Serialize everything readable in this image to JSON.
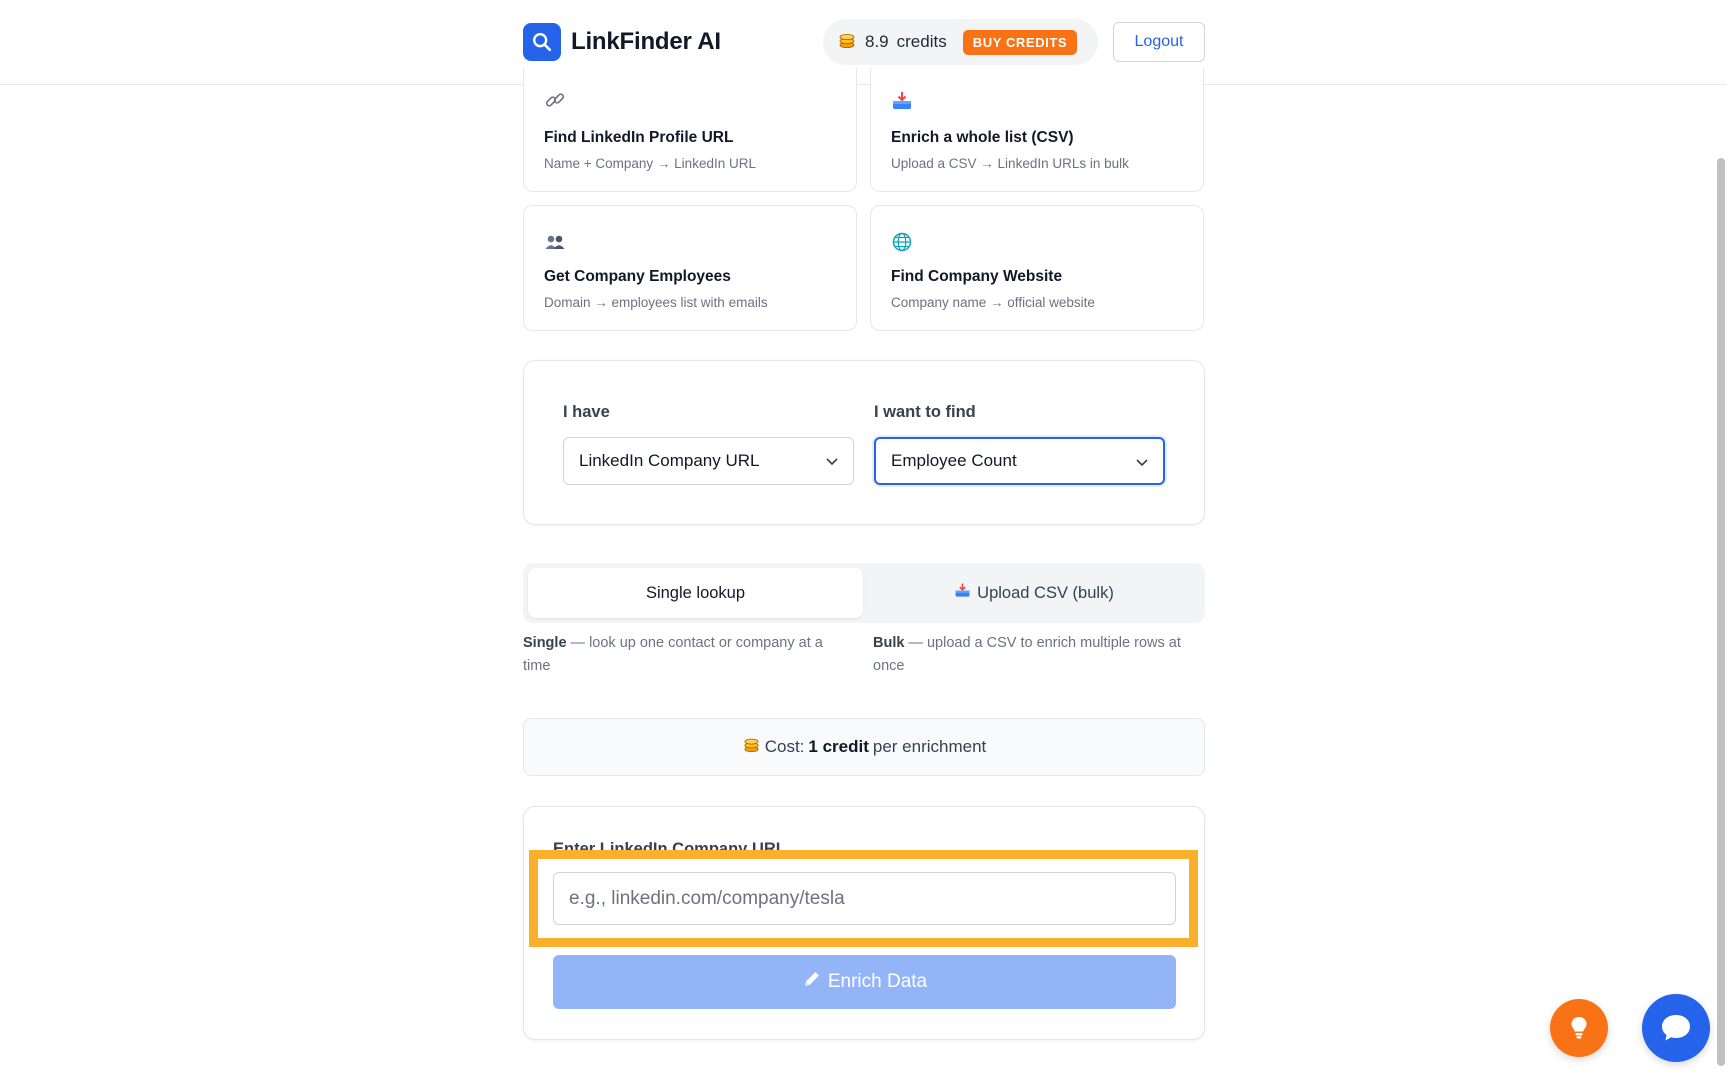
{
  "header": {
    "app_name": "LinkFinder AI",
    "credits_value": "8.9",
    "credits_label": "credits",
    "buy_label": "BUY CREDITS",
    "logout_label": "Logout"
  },
  "cards": [
    {
      "title": "Find LinkedIn Profile URL",
      "subtitle": "Name + Company → LinkedIn URL",
      "icon": "link-icon"
    },
    {
      "title": "Enrich a whole list (CSV)",
      "subtitle": "Upload a CSV → LinkedIn URLs in bulk",
      "icon": "inbox-tray-icon"
    },
    {
      "title": "Get Company Employees",
      "subtitle": "Domain → employees list with emails",
      "icon": "people-icon"
    },
    {
      "title": "Find Company Website",
      "subtitle": "Company name → official website",
      "icon": "globe-icon"
    }
  ],
  "picker": {
    "have_label": "I have",
    "have_value": "LinkedIn Company URL",
    "find_label": "I want to find",
    "find_value": "Employee Count"
  },
  "mode": {
    "single_label": "Single lookup",
    "bulk_label": "Upload CSV (bulk)",
    "single_desc_bold": "Single",
    "single_desc": " — look up one contact or company at a time",
    "bulk_desc_bold": "Bulk",
    "bulk_desc": " — upload a CSV to enrich multiple rows at once"
  },
  "cost": {
    "prefix": "Cost:",
    "amount": "1 credit",
    "suffix": "per enrichment"
  },
  "form": {
    "label": "Enter LinkedIn Company URL",
    "placeholder": "e.g., linkedin.com/company/tesla",
    "button_label": "Enrich Data"
  },
  "colors": {
    "primary": "#2563eb",
    "accent_orange": "#f97316",
    "highlight": "#fbb02d",
    "button_disabled": "#93b4f7"
  }
}
